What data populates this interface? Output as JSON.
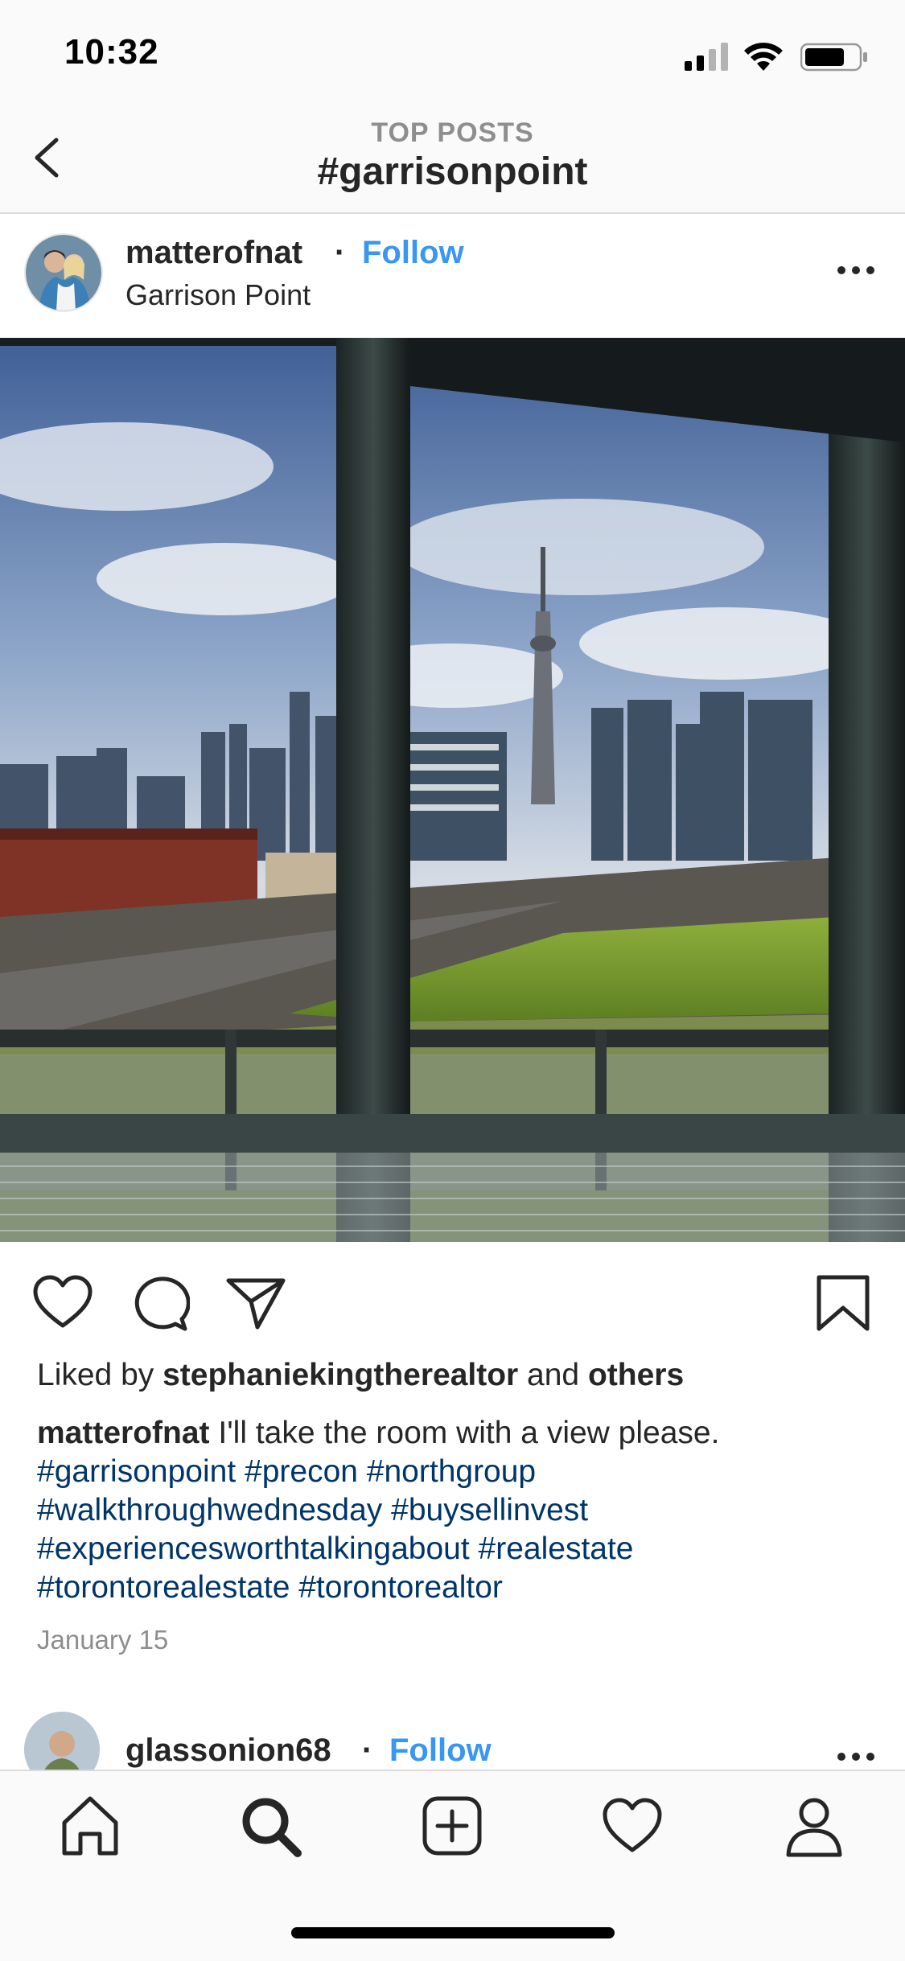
{
  "status_bar": {
    "time": "10:32"
  },
  "header": {
    "subtitle": "TOP POSTS",
    "title": "#garrisonpoint"
  },
  "post": {
    "username": "matterofnat",
    "separator": "·",
    "follow_label": "Follow",
    "location": "Garrison Point",
    "likes": {
      "prefix": "Liked by ",
      "user": "stephaniekingtherealtor",
      "middle": " and ",
      "others": "others"
    },
    "caption": {
      "username": "matterofnat",
      "text": " I'll take the room with a view please.",
      "hashtags": [
        "#garrisonpoint",
        "#precon",
        "#northgroup",
        "#walkthroughwednesday",
        "#buysellinvest",
        "#experiencesworthtalkingabout",
        "#realestate",
        "#torontorealestate",
        "#torontorealtor"
      ]
    },
    "date": "January 15"
  },
  "next_post": {
    "username": "glassonion68",
    "separator": "·",
    "follow_label": "Follow"
  },
  "colors": {
    "link_blue": "#3897f0",
    "hashtag_blue": "#003569",
    "secondary_text": "#8e8e8e"
  },
  "icons": {
    "back": "chevron-left-icon",
    "more": "more-horizontal-icon",
    "like": "heart-icon",
    "comment": "comment-icon",
    "share": "paper-plane-icon",
    "save": "bookmark-icon",
    "tabs": [
      "home-icon",
      "search-icon",
      "add-post-icon",
      "activity-heart-icon",
      "profile-icon"
    ]
  }
}
